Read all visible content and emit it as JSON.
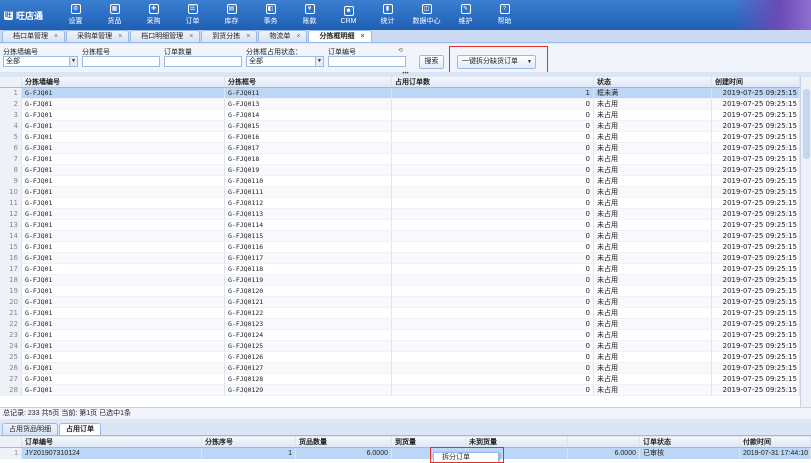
{
  "app": {
    "logo_text": "旺店通"
  },
  "menu": [
    {
      "label": "设置",
      "icon": "gear-icon",
      "glyph": "⚙"
    },
    {
      "label": "货品",
      "icon": "goods-icon",
      "glyph": "▦"
    },
    {
      "label": "采购",
      "icon": "purchase-icon",
      "glyph": "✚"
    },
    {
      "label": "订单",
      "icon": "order-icon",
      "glyph": "☰"
    },
    {
      "label": "库存",
      "icon": "stock-icon",
      "glyph": "▤"
    },
    {
      "label": "事务",
      "icon": "affairs-icon",
      "glyph": "◧"
    },
    {
      "label": "账款",
      "icon": "account-icon",
      "glyph": "¥"
    },
    {
      "label": "CRM",
      "icon": "crm-icon",
      "glyph": "☻"
    },
    {
      "label": "统计",
      "icon": "stats-icon",
      "glyph": "▮"
    },
    {
      "label": "数据中心",
      "icon": "data-center-icon",
      "glyph": "◫"
    },
    {
      "label": "维护",
      "icon": "maintain-icon",
      "glyph": "✎"
    },
    {
      "label": "帮助",
      "icon": "help-icon",
      "glyph": "?"
    }
  ],
  "tabs": [
    {
      "label": "档口单管理",
      "active": false
    },
    {
      "label": "采购单管理",
      "active": false
    },
    {
      "label": "档口明细管理",
      "active": false
    },
    {
      "label": "到货分拣",
      "active": false
    },
    {
      "label": "物流单",
      "active": false
    },
    {
      "label": "分拣框明细",
      "active": true
    }
  ],
  "filter": {
    "wall_label": "分拣墙编号",
    "wall_value": "全部",
    "cell_label": "分拣框号",
    "cell_value": "",
    "order_qty_label": "订单数量",
    "order_qty_value": "",
    "status_label": "分拣框占用状态：",
    "status_value": "全部",
    "order_no_label": "订单编号",
    "order_no_value": "",
    "search_button": "搜索",
    "split_button": "一键拆分缺货订单",
    "splitter_glyph": "•••"
  },
  "grid": {
    "headers": [
      "分拣墙编号",
      "分拣框号",
      "占用订单数",
      "状态",
      "创建时间"
    ],
    "rows": [
      [
        "G-FJQ01",
        "G-FJQ011",
        "1",
        "框未满",
        "2019-07-25 09:25:15"
      ],
      [
        "G-FJQ01",
        "G-FJQ013",
        "0",
        "未占用",
        "2019-07-25 09:25:15"
      ],
      [
        "G-FJQ01",
        "G-FJQ014",
        "0",
        "未占用",
        "2019-07-25 09:25:15"
      ],
      [
        "G-FJQ01",
        "G-FJQ015",
        "0",
        "未占用",
        "2019-07-25 09:25:15"
      ],
      [
        "G-FJQ01",
        "G-FJQ016",
        "0",
        "未占用",
        "2019-07-25 09:25:15"
      ],
      [
        "G-FJQ01",
        "G-FJQ017",
        "0",
        "未占用",
        "2019-07-25 09:25:15"
      ],
      [
        "G-FJQ01",
        "G-FJQ018",
        "0",
        "未占用",
        "2019-07-25 09:25:15"
      ],
      [
        "G-FJQ01",
        "G-FJQ019",
        "0",
        "未占用",
        "2019-07-25 09:25:15"
      ],
      [
        "G-FJQ01",
        "G-FJQ0110",
        "0",
        "未占用",
        "2019-07-25 09:25:15"
      ],
      [
        "G-FJQ01",
        "G-FJQ0111",
        "0",
        "未占用",
        "2019-07-25 09:25:15"
      ],
      [
        "G-FJQ01",
        "G-FJQ0112",
        "0",
        "未占用",
        "2019-07-25 09:25:15"
      ],
      [
        "G-FJQ01",
        "G-FJQ0113",
        "0",
        "未占用",
        "2019-07-25 09:25:15"
      ],
      [
        "G-FJQ01",
        "G-FJQ0114",
        "0",
        "未占用",
        "2019-07-25 09:25:15"
      ],
      [
        "G-FJQ01",
        "G-FJQ0115",
        "0",
        "未占用",
        "2019-07-25 09:25:15"
      ],
      [
        "G-FJQ01",
        "G-FJQ0116",
        "0",
        "未占用",
        "2019-07-25 09:25:15"
      ],
      [
        "G-FJQ01",
        "G-FJQ0117",
        "0",
        "未占用",
        "2019-07-25 09:25:15"
      ],
      [
        "G-FJQ01",
        "G-FJQ0118",
        "0",
        "未占用",
        "2019-07-25 09:25:15"
      ],
      [
        "G-FJQ01",
        "G-FJQ0119",
        "0",
        "未占用",
        "2019-07-25 09:25:15"
      ],
      [
        "G-FJQ01",
        "G-FJQ0120",
        "0",
        "未占用",
        "2019-07-25 09:25:15"
      ],
      [
        "G-FJQ01",
        "G-FJQ0121",
        "0",
        "未占用",
        "2019-07-25 09:25:15"
      ],
      [
        "G-FJQ01",
        "G-FJQ0122",
        "0",
        "未占用",
        "2019-07-25 09:25:15"
      ],
      [
        "G-FJQ01",
        "G-FJQ0123",
        "0",
        "未占用",
        "2019-07-25 09:25:15"
      ],
      [
        "G-FJQ01",
        "G-FJQ0124",
        "0",
        "未占用",
        "2019-07-25 09:25:15"
      ],
      [
        "G-FJQ01",
        "G-FJQ0125",
        "0",
        "未占用",
        "2019-07-25 09:25:15"
      ],
      [
        "G-FJQ01",
        "G-FJQ0126",
        "0",
        "未占用",
        "2019-07-25 09:25:15"
      ],
      [
        "G-FJQ01",
        "G-FJQ0127",
        "0",
        "未占用",
        "2019-07-25 09:25:15"
      ],
      [
        "G-FJQ01",
        "G-FJQ0128",
        "0",
        "未占用",
        "2019-07-25 09:25:15"
      ],
      [
        "G-FJQ01",
        "G-FJQ0129",
        "0",
        "未占用",
        "2019-07-25 09:25:15"
      ]
    ]
  },
  "pager": {
    "text": "总记录: 233  共5页  当前: 第1页  已选中1条"
  },
  "bottom_tabs": [
    {
      "label": "占用货品明细",
      "active": false
    },
    {
      "label": "占用订单",
      "active": true
    }
  ],
  "bottom_grid": {
    "headers": [
      "订单编号",
      "分拣序号",
      "货品数量",
      "到货量",
      "未到货量",
      "",
      "订单状态",
      "付款时间"
    ],
    "row": [
      "JY201907310124",
      "1",
      "6.0000",
      "",
      "",
      "6.0000",
      "已审核",
      "2019-07-31 17:44:10"
    ]
  },
  "context_menu": {
    "item": "拆分订单"
  },
  "colors": {
    "highlight": "#e03030",
    "topbar": "#1f5fb4",
    "selected_row": "#bcd6f5"
  }
}
